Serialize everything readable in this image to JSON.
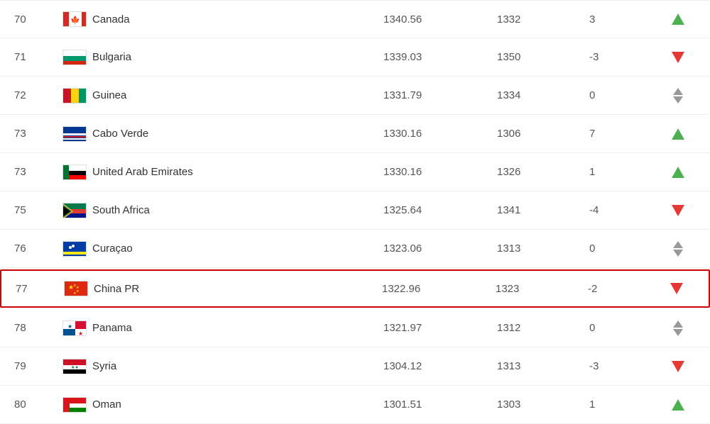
{
  "rows": [
    {
      "rank": "70",
      "country": "Canada",
      "points": "1340.56",
      "prev": "1332",
      "change": "3",
      "trend": "up",
      "flag": "canada"
    },
    {
      "rank": "71",
      "country": "Bulgaria",
      "points": "1339.03",
      "prev": "1350",
      "change": "-3",
      "trend": "down",
      "flag": "bulgaria"
    },
    {
      "rank": "72",
      "country": "Guinea",
      "points": "1331.79",
      "prev": "1334",
      "change": "0",
      "trend": "neutral",
      "flag": "guinea"
    },
    {
      "rank": "73",
      "country": "Cabo Verde",
      "points": "1330.16",
      "prev": "1306",
      "change": "7",
      "trend": "up",
      "flag": "caboverde"
    },
    {
      "rank": "73",
      "country": "United Arab Emirates",
      "points": "1330.16",
      "prev": "1326",
      "change": "1",
      "trend": "up",
      "flag": "uae"
    },
    {
      "rank": "75",
      "country": "South Africa",
      "points": "1325.64",
      "prev": "1341",
      "change": "-4",
      "trend": "down",
      "flag": "southafrica"
    },
    {
      "rank": "76",
      "country": "Curaçao",
      "points": "1323.06",
      "prev": "1313",
      "change": "0",
      "trend": "neutral",
      "flag": "curacao"
    },
    {
      "rank": "77",
      "country": "China PR",
      "points": "1322.96",
      "prev": "1323",
      "change": "-2",
      "trend": "down",
      "flag": "china",
      "highlighted": true
    },
    {
      "rank": "78",
      "country": "Panama",
      "points": "1321.97",
      "prev": "1312",
      "change": "0",
      "trend": "neutral",
      "flag": "panama"
    },
    {
      "rank": "79",
      "country": "Syria",
      "points": "1304.12",
      "prev": "1313",
      "change": "-3",
      "trend": "down",
      "flag": "syria"
    },
    {
      "rank": "80",
      "country": "Oman",
      "points": "1301.51",
      "prev": "1303",
      "change": "1",
      "trend": "up",
      "flag": "oman"
    }
  ]
}
